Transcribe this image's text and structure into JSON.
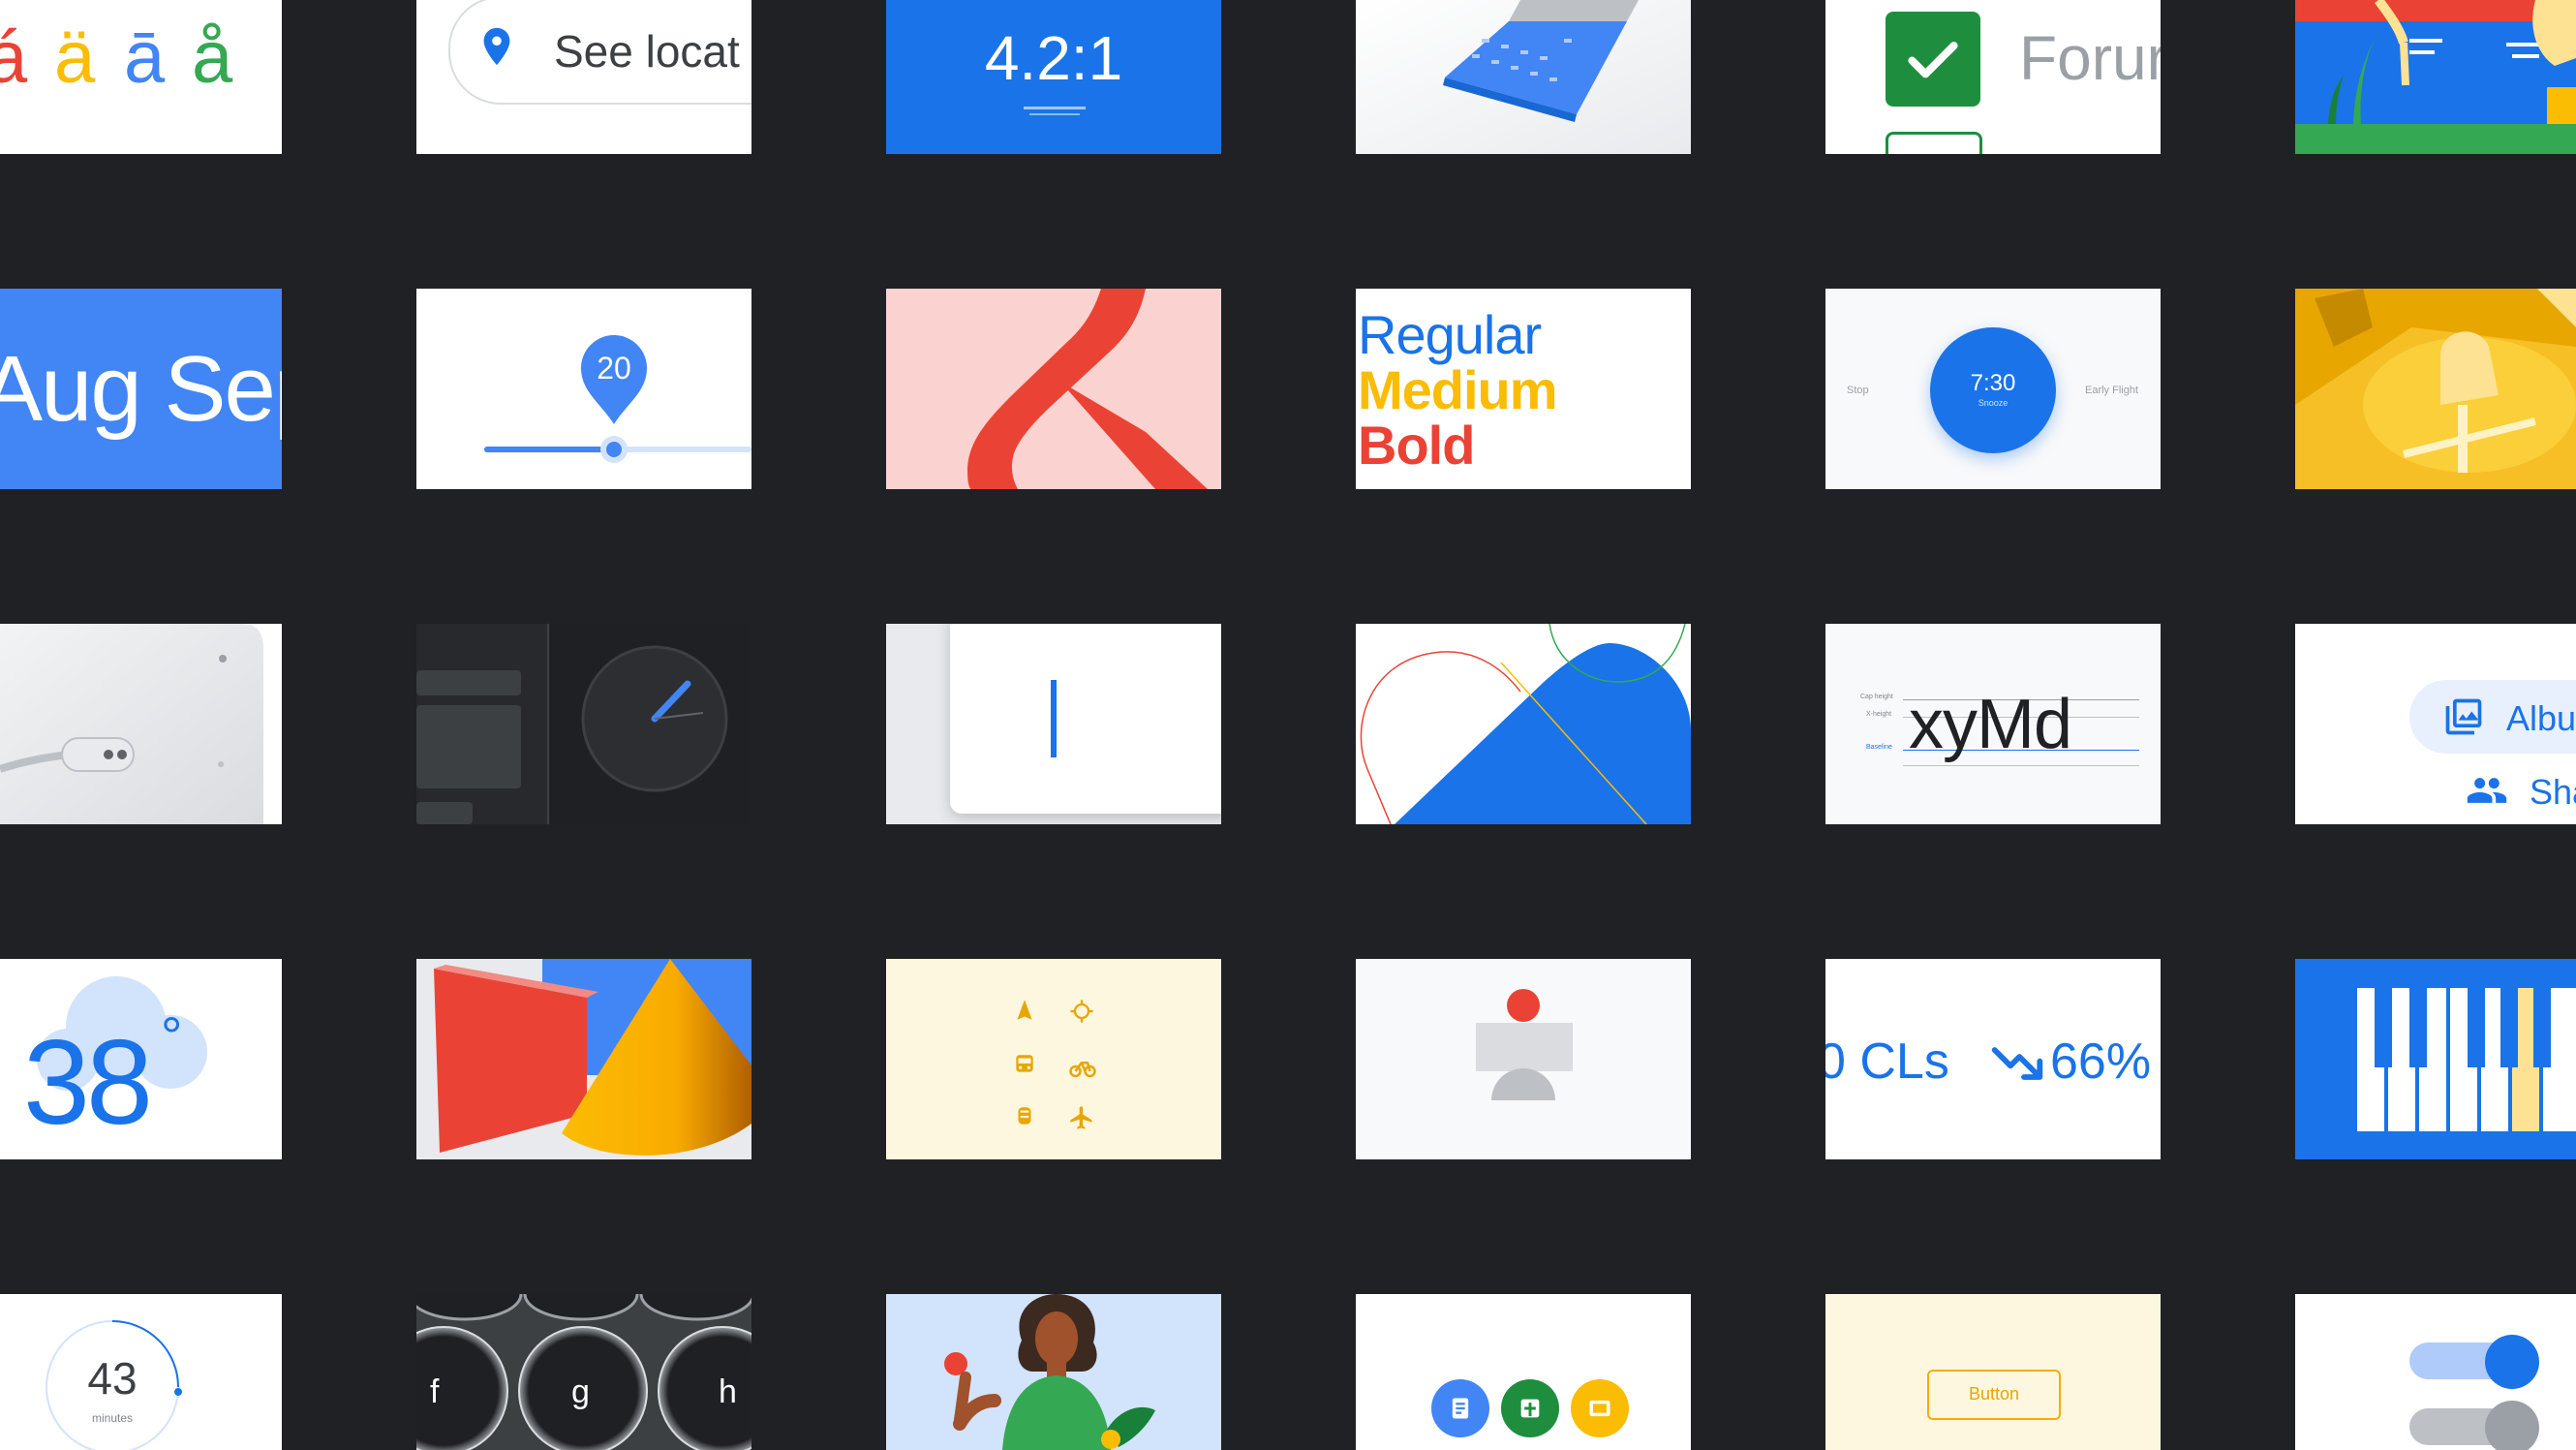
{
  "tiles": {
    "accents": {
      "letters": [
        "á",
        "ä",
        "ā",
        "å"
      ],
      "colors": [
        "#ea4335",
        "#fbbc04",
        "#4285f4",
        "#34a853"
      ]
    },
    "see_location": {
      "label": "See locat"
    },
    "ratio": {
      "value": "4.2:1"
    },
    "forum": {
      "label": "Forur"
    },
    "months": {
      "label": "Aug Sep"
    },
    "slider_pin": {
      "value": "20"
    },
    "weights": {
      "regular": "Regular",
      "medium": "Medium",
      "bold": "Bold"
    },
    "alarm": {
      "time": "7:30",
      "action": "Snooze",
      "left": "Stop",
      "right": "Early Flight"
    },
    "xymd": {
      "label": "xyMd",
      "cap_height": "Cap height",
      "x_height": "X-height",
      "baseline": "Baseline"
    },
    "album": {
      "albums": "Albu",
      "sharing": "Sha"
    },
    "weather": {
      "value": "38",
      "unit": "°"
    },
    "stats": {
      "left": "0 CLs",
      "right": "66%"
    },
    "timer": {
      "value": "43",
      "unit": "minutes"
    },
    "keys": {
      "labels": [
        "f",
        "g",
        "h"
      ]
    },
    "button_demo": {
      "label": "Button"
    }
  },
  "colors": {
    "background": "#202124",
    "blue": "#1a73e8",
    "red": "#ea4335",
    "yellow": "#fbbc04",
    "green": "#34a853"
  }
}
